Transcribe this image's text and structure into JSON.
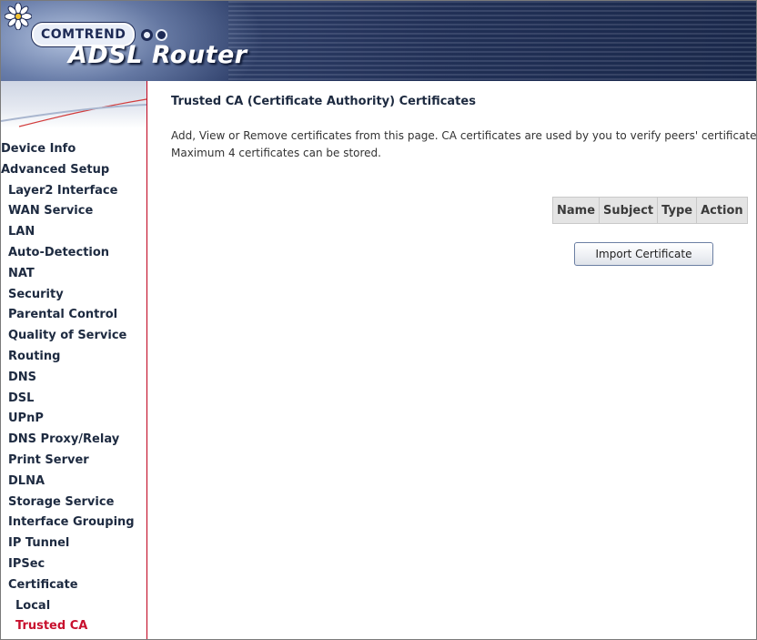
{
  "header": {
    "brand": "COMTREND",
    "product": "ADSL Router"
  },
  "menu": {
    "items": [
      {
        "label": "Device Info",
        "level": 0
      },
      {
        "label": "Advanced Setup",
        "level": 0
      },
      {
        "label": "Layer2 Interface",
        "level": 1
      },
      {
        "label": "WAN Service",
        "level": 1
      },
      {
        "label": "LAN",
        "level": 1
      },
      {
        "label": "Auto-Detection",
        "level": 1
      },
      {
        "label": "NAT",
        "level": 1
      },
      {
        "label": "Security",
        "level": 1
      },
      {
        "label": "Parental Control",
        "level": 1
      },
      {
        "label": "Quality of Service",
        "level": 1
      },
      {
        "label": "Routing",
        "level": 1
      },
      {
        "label": "DNS",
        "level": 1
      },
      {
        "label": "DSL",
        "level": 1
      },
      {
        "label": "UPnP",
        "level": 1
      },
      {
        "label": "DNS Proxy/Relay",
        "level": 1
      },
      {
        "label": "Print Server",
        "level": 1
      },
      {
        "label": "DLNA",
        "level": 1
      },
      {
        "label": "Storage Service",
        "level": 1
      },
      {
        "label": "Interface Grouping",
        "level": 1
      },
      {
        "label": "IP Tunnel",
        "level": 1
      },
      {
        "label": "IPSec",
        "level": 1
      },
      {
        "label": "Certificate",
        "level": 1
      },
      {
        "label": "Local",
        "level": 2
      },
      {
        "label": "Trusted CA",
        "level": 2,
        "active": true
      }
    ]
  },
  "page": {
    "title": "Trusted CA (Certificate Authority) Certificates",
    "description_line1": "Add, View or Remove certificates from this page. CA certificates are used by you to verify peers' certificates.",
    "description_line2": "Maximum 4 certificates can be stored."
  },
  "table": {
    "columns": [
      "Name",
      "Subject",
      "Type",
      "Action"
    ],
    "rows": []
  },
  "buttons": {
    "import_label": "Import Certificate"
  },
  "colors": {
    "active_menu": "#c8102e",
    "menu_text": "#1d2a40",
    "left_border": "#c0001a"
  }
}
